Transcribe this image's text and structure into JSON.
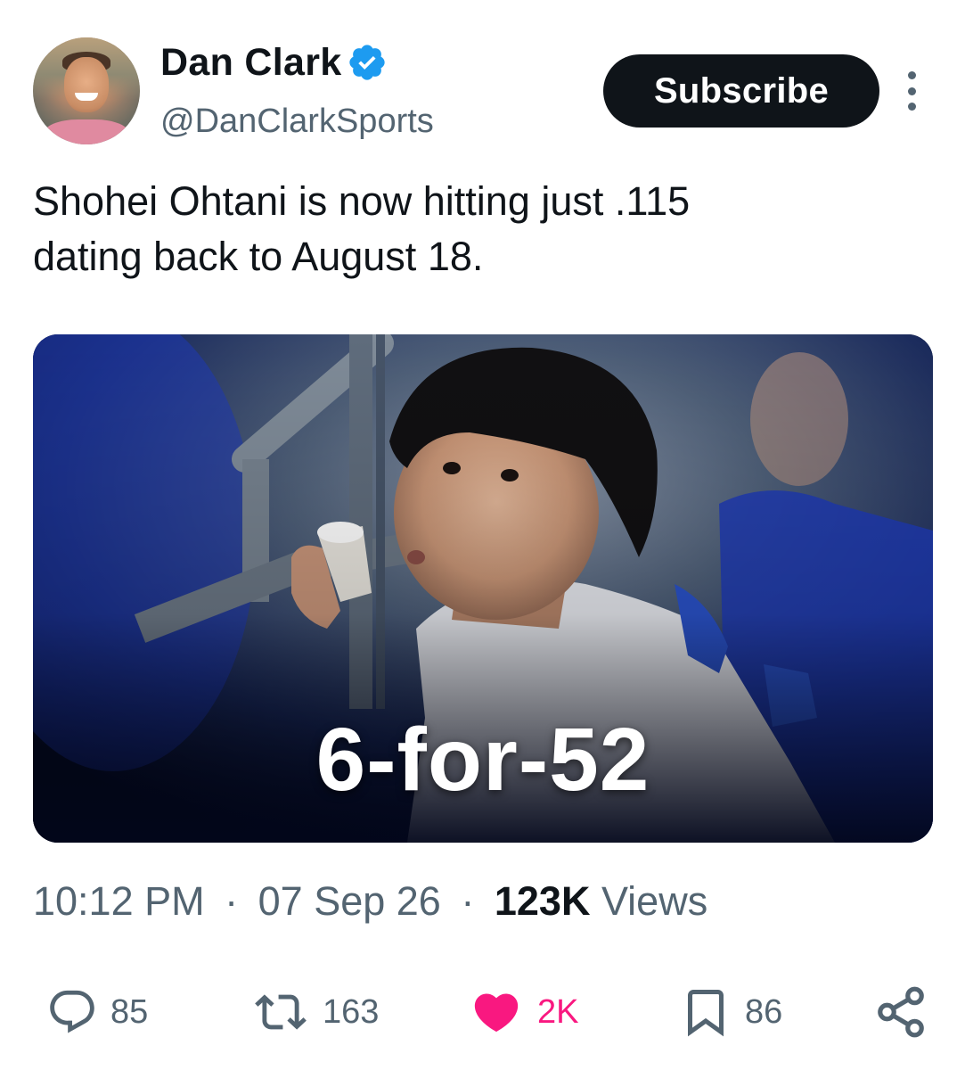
{
  "author": {
    "display_name": "Dan Clark",
    "handle": "@DanClarkSports",
    "verified": true,
    "verified_color": "#1d9bf0"
  },
  "header": {
    "subscribe_label": "Subscribe",
    "more_icon": "more-vertical-icon"
  },
  "tweet": {
    "text": "Shohei Ohtani is now hitting just .115\ndating back to August 18.",
    "media_caption": "6-for-52"
  },
  "meta": {
    "time": "10:12 PM",
    "date": "07 Sep 26",
    "views_count": "123K",
    "views_label": "Views",
    "separator": "·"
  },
  "actions": {
    "replies": {
      "icon": "reply-icon",
      "count": "85"
    },
    "reposts": {
      "icon": "repost-icon",
      "count": "163"
    },
    "likes": {
      "icon": "heart-icon",
      "count": "2K",
      "liked": true,
      "color": "#f91880"
    },
    "bookmarks": {
      "icon": "bookmark-icon",
      "count": "86"
    },
    "share": {
      "icon": "share-icon"
    }
  },
  "colors": {
    "text_primary": "#0f1419",
    "text_secondary": "#536471",
    "button_bg": "#0f1419",
    "like_pink": "#f91880"
  }
}
